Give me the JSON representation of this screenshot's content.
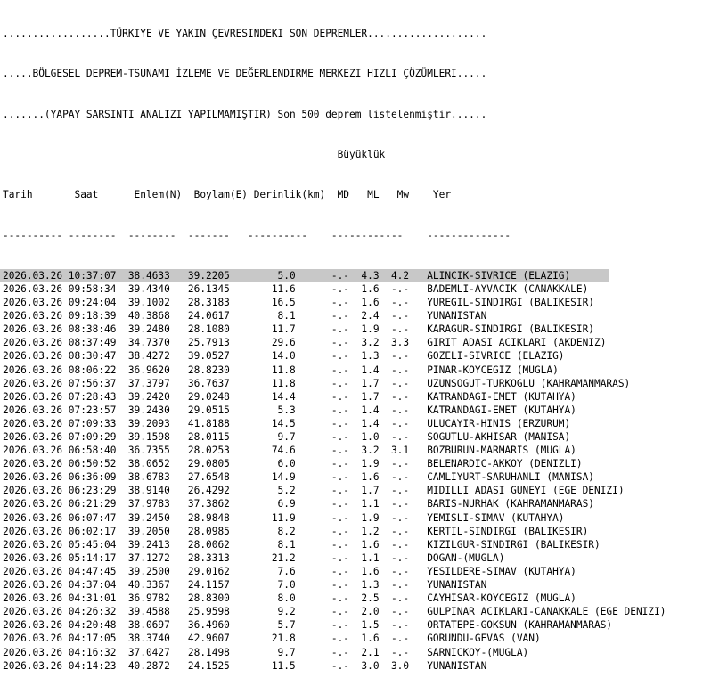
{
  "header": {
    "line1": "..................TÜRKIYE VE YAKIN ÇEVRESINDEKI SON DEPREMLER....................",
    "line2": ".....BÖLGESEL DEPREM-TSUNAMI İZLEME VE DEĞERLENDIRME MERKEZI HIZLI ÇÖZÜMLERI.....",
    "line3": ".......(YAPAY SARSINTI ANALIZI YAPILMAMIŞTIR) Son 500 deprem listelenmiştir......",
    "line4": "                                                        Büyüklük",
    "columns": "Tarih       Saat      Enlem(N)  Boylam(E) Derinlik(km)  MD   ML   Mw    Yer",
    "separator": "---------- --------  --------  -------   ----------    ------------    --------------"
  },
  "rows": [
    {
      "line": "2026.03.26 10:37:07  38.4633   39.2205        5.0      -.-  4.3  4.2   ALINCIK-SIVRICE (ELAZIG)"
    },
    {
      "line": "2026.03.26 09:58:34  39.4340   26.1345       11.6      -.-  1.6  -.-   BADEMLI-AYVACIK (CANAKKALE)"
    },
    {
      "line": "2026.03.26 09:24:04  39.1002   28.3183       16.5      -.-  1.6  -.-   YUREGIL-SINDIRGI (BALIKESIR)"
    },
    {
      "line": "2026.03.26 09:18:39  40.3868   24.0617        8.1      -.-  2.4  -.-   YUNANISTAN"
    },
    {
      "line": "2026.03.26 08:38:46  39.2480   28.1080       11.7      -.-  1.9  -.-   KARAGUR-SINDIRGI (BALIKESIR)"
    },
    {
      "line": "2026.03.26 08:37:49  34.7370   25.7913       29.6      -.-  3.2  3.3   GIRIT ADASI ACIKLARI (AKDENIZ)"
    },
    {
      "line": "2026.03.26 08:30:47  38.4272   39.0527       14.0      -.-  1.3  -.-   GOZELI-SIVRICE (ELAZIG)"
    },
    {
      "line": "2026.03.26 08:06:22  36.9620   28.8230       11.8      -.-  1.4  -.-   PINAR-KOYCEGIZ (MUGLA)"
    },
    {
      "line": "2026.03.26 07:56:37  37.3797   36.7637       11.8      -.-  1.7  -.-   UZUNSOGUT-TURKOGLU (KAHRAMANMARAS)"
    },
    {
      "line": "2026.03.26 07:28:43  39.2420   29.0248       14.4      -.-  1.7  -.-   KATRANDAGI-EMET (KUTAHYA)"
    },
    {
      "line": "2026.03.26 07:23:57  39.2430   29.0515        5.3      -.-  1.4  -.-   KATRANDAGI-EMET (KUTAHYA)"
    },
    {
      "line": "2026.03.26 07:09:33  39.2093   41.8188       14.5      -.-  1.4  -.-   ULUCAYIR-HINIS (ERZURUM)"
    },
    {
      "line": "2026.03.26 07:09:29  39.1598   28.0115        9.7      -.-  1.0  -.-   SOGUTLU-AKHISAR (MANISA)"
    },
    {
      "line": "2026.03.26 06:58:40  36.7355   28.0253       74.6      -.-  3.2  3.1   BOZBURUN-MARMARIS (MUGLA)"
    },
    {
      "line": "2026.03.26 06:50:52  38.0652   29.0805        6.0      -.-  1.9  -.-   BELENARDIC-AKKOY (DENIZLI)"
    },
    {
      "line": "2026.03.26 06:36:09  38.6783   27.6548       14.9      -.-  1.6  -.-   CAMLIYURT-SARUHANLI (MANISA)"
    },
    {
      "line": "2026.03.26 06:23:29  38.9140   26.4292        5.2      -.-  1.7  -.-   MIDILLI ADASI GUNEYI (EGE DENIZI)"
    },
    {
      "line": "2026.03.26 06:21:29  37.9783   37.3862        6.9      -.-  1.1  -.-   BARIS-NURHAK (KAHRAMANMARAS)"
    },
    {
      "line": "2026.03.26 06:07:47  39.2450   28.9848       11.9      -.-  1.9  -.-   YEMISLI-SIMAV (KUTAHYA)"
    },
    {
      "line": "2026.03.26 06:02:17  39.2050   28.0985        8.2      -.-  1.2  -.-   KERTIL-SINDIRGI (BALIKESIR)"
    },
    {
      "line": "2026.03.26 05:45:04  39.2413   28.0062        8.1      -.-  1.6  -.-   KIZILGUR-SINDIRGI (BALIKESIR)"
    },
    {
      "line": "2026.03.26 05:14:17  37.1272   28.3313       21.2      -.-  1.1  -.-   DOGAN-(MUGLA)"
    },
    {
      "line": "2026.03.26 04:47:45  39.2500   29.0162        7.6      -.-  1.6  -.-   YESILDERE-SIMAV (KUTAHYA)"
    },
    {
      "line": "2026.03.26 04:37:04  40.3367   24.1157        7.0      -.-  1.3  -.-   YUNANISTAN"
    },
    {
      "line": "2026.03.26 04:31:01  36.9782   28.8300        8.0      -.-  2.5  -.-   CAYHISAR-KOYCEGIZ (MUGLA)"
    },
    {
      "line": "2026.03.26 04:26:32  39.4588   25.9598        9.2      -.-  2.0  -.-   GULPINAR ACIKLARI-CANAKKALE (EGE DENIZI)"
    },
    {
      "line": "2026.03.26 04:20:48  38.0697   36.4960        5.7      -.-  1.5  -.-   ORTATEPE-GOKSUN (KAHRAMANMARAS)"
    },
    {
      "line": "2026.03.26 04:17:05  38.3740   42.9607       21.8      -.-  1.6  -.-   GORUNDU-GEVAS (VAN)"
    },
    {
      "line": "2026.03.26 04:16:32  37.0427   28.1498        9.7      -.-  2.1  -.-   SARNICKOY-(MUGLA)"
    },
    {
      "line": "2026.03.26 04:14:23  40.2872   24.1525       11.5      -.-  3.0  3.0   YUNANISTAN"
    }
  ],
  "highlight_color": "#c8c8c8"
}
